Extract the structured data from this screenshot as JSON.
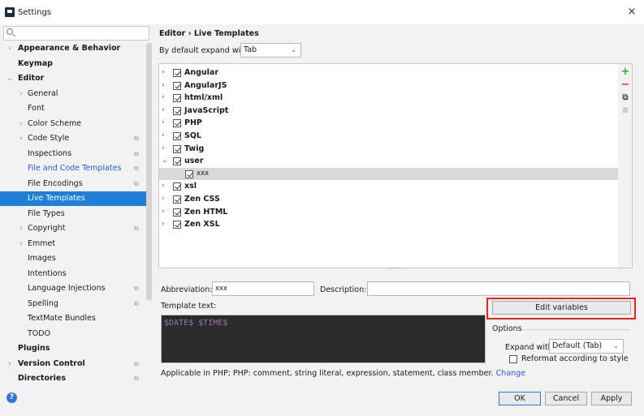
{
  "window": {
    "title": "Settings",
    "close": "×"
  },
  "sidebar": {
    "search_placeholder": "",
    "items": [
      {
        "label": "Appearance & Behavior",
        "arrow": "›",
        "badge": ""
      },
      {
        "label": "Keymap",
        "arrow": "",
        "badge": ""
      },
      {
        "label": "Editor",
        "arrow": "⌄",
        "badge": ""
      },
      {
        "label": "General",
        "arrow": "›",
        "badge": ""
      },
      {
        "label": "Font",
        "arrow": "",
        "badge": ""
      },
      {
        "label": "Color Scheme",
        "arrow": "›",
        "badge": ""
      },
      {
        "label": "Code Style",
        "arrow": "›",
        "badge": "⧉"
      },
      {
        "label": "Inspections",
        "arrow": "",
        "badge": "⧉"
      },
      {
        "label": "File and Code Templates",
        "arrow": "",
        "badge": "⧉"
      },
      {
        "label": "File Encodings",
        "arrow": "",
        "badge": "⧉"
      },
      {
        "label": "Live Templates",
        "arrow": "",
        "badge": ""
      },
      {
        "label": "File Types",
        "arrow": "",
        "badge": ""
      },
      {
        "label": "Copyright",
        "arrow": "›",
        "badge": "⧉"
      },
      {
        "label": "Emmet",
        "arrow": "›",
        "badge": ""
      },
      {
        "label": "Images",
        "arrow": "",
        "badge": ""
      },
      {
        "label": "Intentions",
        "arrow": "",
        "badge": ""
      },
      {
        "label": "Language Injections",
        "arrow": "",
        "badge": "⧉"
      },
      {
        "label": "Spelling",
        "arrow": "",
        "badge": "⧉"
      },
      {
        "label": "TextMate Bundles",
        "arrow": "",
        "badge": ""
      },
      {
        "label": "TODO",
        "arrow": "",
        "badge": ""
      },
      {
        "label": "Plugins",
        "arrow": "",
        "badge": ""
      },
      {
        "label": "Version Control",
        "arrow": "›",
        "badge": "⧉"
      },
      {
        "label": "Directories",
        "arrow": "",
        "badge": "⧉"
      }
    ],
    "selected": "Live Templates",
    "help": "?"
  },
  "main": {
    "breadcrumb": "Editor › Live Templates",
    "expand_label": "By default expand with",
    "expand_value": "Tab",
    "templates": [
      {
        "label": "Angular",
        "arrow": "›"
      },
      {
        "label": "AngularJS",
        "arrow": "›"
      },
      {
        "label": "html/xml",
        "arrow": "›"
      },
      {
        "label": "JavaScript",
        "arrow": "›"
      },
      {
        "label": "PHP",
        "arrow": "›"
      },
      {
        "label": "SQL",
        "arrow": "›"
      },
      {
        "label": "Twig",
        "arrow": "›"
      },
      {
        "label": "user",
        "arrow": "⌄"
      },
      {
        "label": "xxx",
        "arrow": ""
      },
      {
        "label": "xsl",
        "arrow": "›"
      },
      {
        "label": "Zen CSS",
        "arrow": "›"
      },
      {
        "label": "Zen HTML",
        "arrow": "›"
      },
      {
        "label": "Zen XSL",
        "arrow": "›"
      }
    ],
    "tools": {
      "add": "+",
      "remove": "−",
      "copy": "⧉",
      "more": "≡"
    },
    "abbreviation_label": "Abbreviation:",
    "abbreviation_value": "xxx",
    "description_label": "Description:",
    "description_value": "",
    "template_text_label": "Template text:",
    "template_text": "$DATE$ $TIME$",
    "edit_variables": "Edit variables",
    "options_label": "Options",
    "expand_with_label": "Expand with",
    "expand_with_value": "Default (Tab)",
    "reformat_label": "Reformat according to style",
    "applicable_text": "Applicable in PHP; PHP: comment, string literal, expression, statement, class member.",
    "change_link": "Change"
  },
  "buttons": {
    "ok": "OK",
    "cancel": "Cancel",
    "apply": "Apply"
  }
}
